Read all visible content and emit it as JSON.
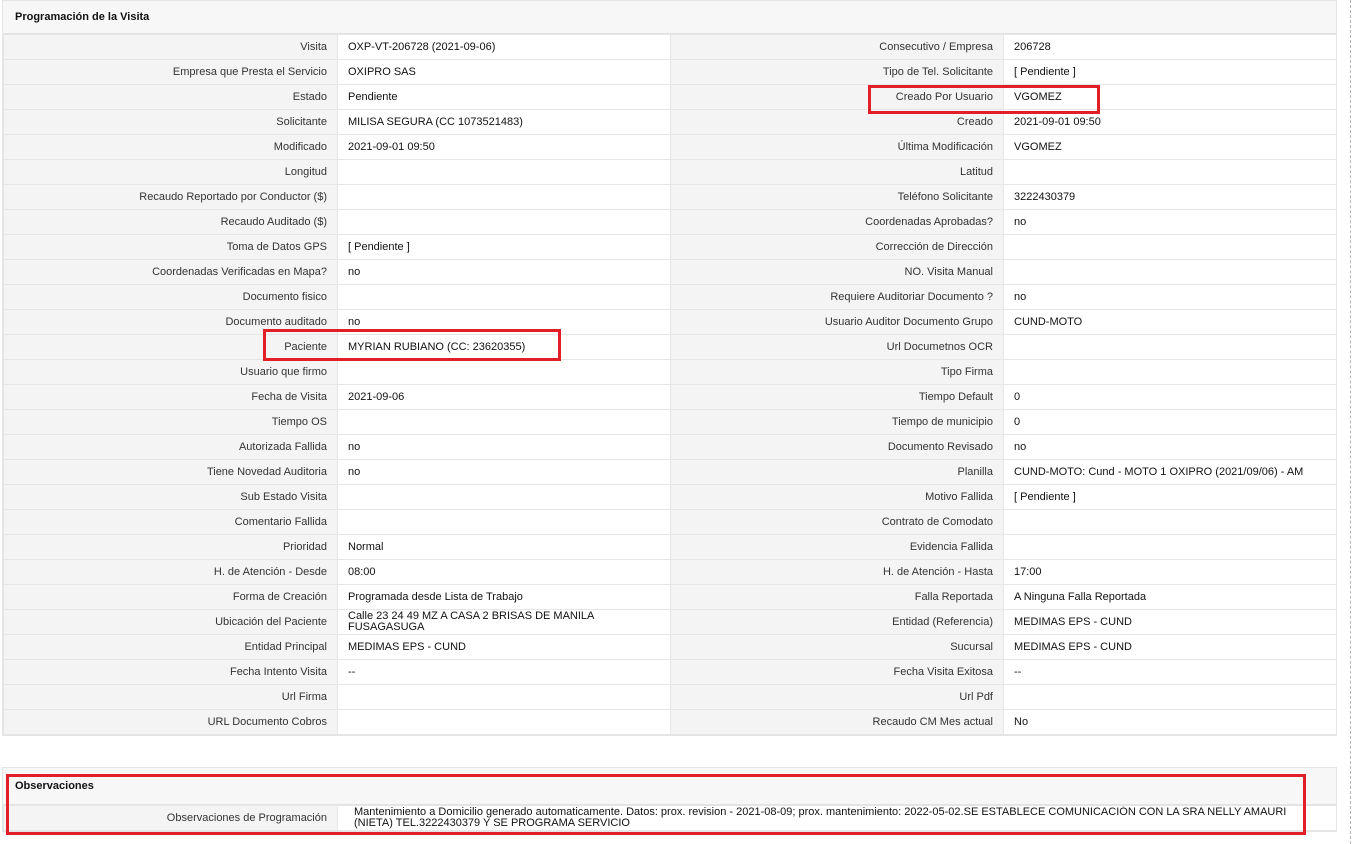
{
  "programacion": {
    "title": "Programación de la Visita",
    "rows": [
      {
        "l1": "Visita",
        "v1": "OXP-VT-206728 (2021-09-06)",
        "l2": "Consecutivo / Empresa",
        "v2": "206728"
      },
      {
        "l1": "Empresa que Presta el Servicio",
        "v1": "OXIPRO SAS",
        "l2": "Tipo de Tel. Solicitante",
        "v2": "[ Pendiente ]"
      },
      {
        "l1": "Estado",
        "v1": "Pendiente",
        "l2": "Creado Por Usuario",
        "v2": "VGOMEZ"
      },
      {
        "l1": "Solicitante",
        "v1": "MILISA SEGURA (CC 1073521483)",
        "l2": "Creado",
        "v2": "2021-09-01 09:50"
      },
      {
        "l1": "Modificado",
        "v1": "2021-09-01 09:50",
        "l2": "Última Modificación",
        "v2": "VGOMEZ"
      },
      {
        "l1": "Longitud",
        "v1": "",
        "l2": "Latitud",
        "v2": ""
      },
      {
        "l1": "Recaudo Reportado por Conductor ($)",
        "v1": "",
        "l2": "Teléfono Solicitante",
        "v2": "3222430379"
      },
      {
        "l1": "Recaudo Auditado ($)",
        "v1": "",
        "l2": "Coordenadas Aprobadas?",
        "v2": "no"
      },
      {
        "l1": "Toma de Datos GPS",
        "v1": "[ Pendiente ]",
        "l2": "Corrección de Dirección",
        "v2": ""
      },
      {
        "l1": "Coordenadas Verificadas en Mapa?",
        "v1": "no",
        "l2": "NO. Visita Manual",
        "v2": ""
      },
      {
        "l1": "Documento fisico",
        "v1": "",
        "l2": "Requiere Auditoriar Documento ?",
        "v2": "no"
      },
      {
        "l1": "Documento auditado",
        "v1": "no",
        "l2": "Usuario Auditor Documento Grupo",
        "v2": "CUND-MOTO"
      },
      {
        "l1": "Paciente",
        "v1": "MYRIAN RUBIANO (CC: 23620355)",
        "l2": "Url Documetnos OCR",
        "v2": ""
      },
      {
        "l1": "Usuario que firmo",
        "v1": "",
        "l2": "Tipo Firma",
        "v2": ""
      },
      {
        "l1": "Fecha de Visita",
        "v1": "2021-09-06",
        "l2": "Tiempo Default",
        "v2": "0"
      },
      {
        "l1": "Tiempo OS",
        "v1": "",
        "l2": "Tiempo de municipio",
        "v2": "0"
      },
      {
        "l1": "Autorizada Fallida",
        "v1": "no",
        "l2": "Documento Revisado",
        "v2": "no"
      },
      {
        "l1": "Tiene Novedad Auditoria",
        "v1": "no",
        "l2": "Planilla",
        "v2": "CUND-MOTO: Cund - MOTO 1 OXIPRO (2021/09/06) - AM"
      },
      {
        "l1": "Sub Estado Visita",
        "v1": "",
        "l2": "Motivo Fallida",
        "v2": "[ Pendiente ]"
      },
      {
        "l1": "Comentario Fallida",
        "v1": "",
        "l2": "Contrato de Comodato",
        "v2": ""
      },
      {
        "l1": "Prioridad",
        "v1": "Normal",
        "l2": "Evidencia Fallida",
        "v2": ""
      },
      {
        "l1": "H. de Atención - Desde",
        "v1": "08:00",
        "l2": "H. de Atención - Hasta",
        "v2": "17:00"
      },
      {
        "l1": "Forma de Creación",
        "v1": "Programada desde Lista de Trabajo",
        "l2": "Falla Reportada",
        "v2": "A Ninguna Falla Reportada"
      },
      {
        "l1": "Ubicación del Paciente",
        "v1": "Calle 23 24 49 MZ A CASA 2 BRISAS DE MANILA FUSAGASUGA",
        "l2": "Entidad (Referencia)",
        "v2": "MEDIMAS EPS - CUND"
      },
      {
        "l1": "Entidad Principal",
        "v1": "MEDIMAS EPS - CUND",
        "l2": "Sucursal",
        "v2": "MEDIMAS EPS - CUND"
      },
      {
        "l1": "Fecha Intento Visita",
        "v1": "--",
        "l2": "Fecha Visita Exitosa",
        "v2": "--"
      },
      {
        "l1": "Url Firma",
        "v1": "",
        "l2": "Url Pdf",
        "v2": ""
      },
      {
        "l1": "URL Documento Cobros",
        "v1": "",
        "l2": "Recaudo CM Mes actual",
        "v2": "No"
      }
    ]
  },
  "observaciones": {
    "title": "Observaciones",
    "label": "Observaciones de Programación",
    "value": "Mantenimiento a Domicilio generado automaticamente. Datos: prox. revision - 2021-08-09; prox. mantenimiento: 2022-05-02.SE ESTABLECE COMUNICACIÓN CON LA SRA NELLY AMAURI (NIETA) TEL.3222430379 Y SE PROGRAMA SERVICIO"
  },
  "highlight_color": "#e01f26"
}
